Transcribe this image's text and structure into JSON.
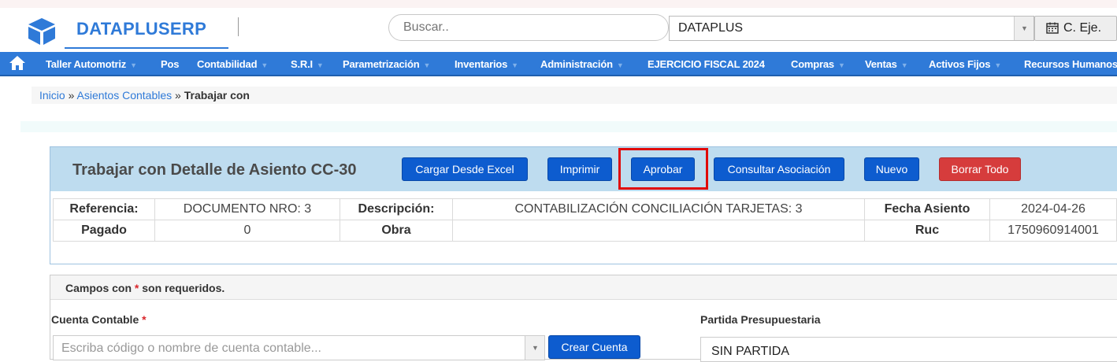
{
  "header": {
    "brand": "DATAPLUSERP",
    "search_placeholder": "Buscar..",
    "company": "DATAPLUS",
    "fiscal_button": "C. Eje."
  },
  "nav": {
    "items": [
      {
        "label": "Taller Automotriz",
        "caret": true
      },
      {
        "label": "Pos",
        "caret": false
      },
      {
        "label": "Contabilidad",
        "caret": true
      },
      {
        "label": "S.R.I",
        "caret": true
      },
      {
        "label": "Parametrización",
        "caret": true
      },
      {
        "label": "Inventarios",
        "caret": true
      },
      {
        "label": "Administración",
        "caret": true
      },
      {
        "label": "EJERCICIO FISCAL 2024",
        "caret": false
      },
      {
        "label": "Compras",
        "caret": true
      },
      {
        "label": "Ventas",
        "caret": true
      },
      {
        "label": "Activos Fijos",
        "caret": true
      },
      {
        "label": "Recursos Humanos",
        "caret": false
      }
    ]
  },
  "breadcrumb": {
    "home": "Inicio",
    "sep": "»",
    "section": "Asientos Contables",
    "current": "Trabajar con"
  },
  "panel": {
    "title": "Trabajar con Detalle de Asiento CC-30",
    "buttons": {
      "excel": "Cargar Desde Excel",
      "print": "Imprimir",
      "approve": "Aprobar",
      "association": "Consultar Asociación",
      "new": "Nuevo",
      "delete_all": "Borrar Todo"
    },
    "info": {
      "referencia_label": "Referencia:",
      "referencia_value": "DOCUMENTO NRO: 3",
      "descripcion_label": "Descripción:",
      "descripcion_value": "CONTABILIZACIÓN CONCILIACIÓN TARJETAS: 3",
      "fecha_label": "Fecha Asiento",
      "fecha_value": "2024-04-26",
      "pagado_label": "Pagado",
      "pagado_value": "0",
      "obra_label": "Obra",
      "obra_value": "",
      "ruc_label": "Ruc",
      "ruc_value": "1750960914001"
    }
  },
  "form": {
    "required_prefix": "Campos con",
    "required_star": "*",
    "required_suffix": "son requeridos.",
    "cuenta_label": "Cuenta Contable",
    "cuenta_placeholder": "Escriba código o nombre de cuenta contable...",
    "crear_cuenta": "Crear Cuenta",
    "partida_label": "Partida Presupuestaria",
    "partida_value": "SIN PARTIDA"
  },
  "colors": {
    "brand_blue": "#2f7ad8",
    "button_blue": "#0d5ccf",
    "button_red": "#d63c3c",
    "highlight_red": "#e00a0a",
    "panel_header": "#bedcef"
  },
  "icons": [
    "cube-logo-icon",
    "home-icon",
    "calendar-icon",
    "chevron-down-icon"
  ]
}
